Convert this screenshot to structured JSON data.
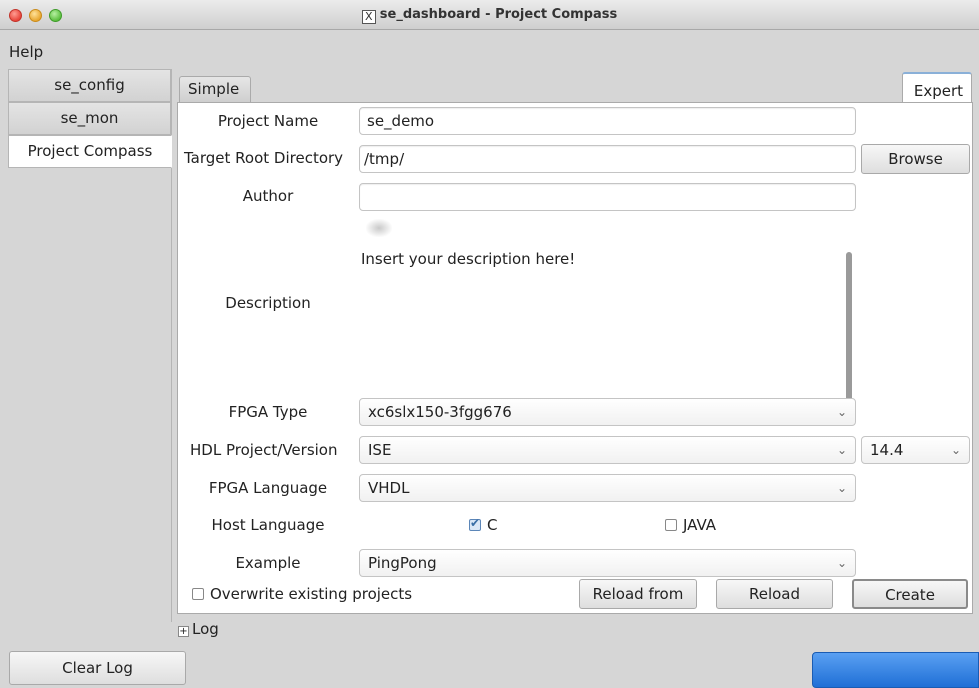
{
  "window": {
    "title": "se_dashboard - Project Compass",
    "x_glyph": "X"
  },
  "menu": {
    "help": "Help"
  },
  "left_tabs": [
    {
      "label": "se_config"
    },
    {
      "label": "se_mon"
    },
    {
      "label": "Project Compass"
    }
  ],
  "tabs": {
    "simple": "Simple",
    "expert": "Expert"
  },
  "form": {
    "project_name_label": "Project Name",
    "project_name_value": "se_demo",
    "target_root_label": "Target Root Directory",
    "target_root_value": "/tmp/",
    "browse_label": "Browse",
    "author_label": "Author",
    "description_label": "Description",
    "description_value": "Insert your description here!",
    "fpga_type_label": "FPGA Type",
    "fpga_type_value": "xc6slx150-3fgg676",
    "hdl_label": "HDL Project/Version",
    "hdl_value": "ISE",
    "hdl_version_value": "14.4",
    "fpga_language_label": "FPGA Language",
    "fpga_language_value": "VHDL",
    "host_language_label": "Host Language",
    "host_c_label": "C",
    "host_java_label": "JAVA",
    "example_label": "Example",
    "example_value": "PingPong",
    "overwrite_label": "Overwrite existing projects",
    "reload_from_label": "Reload from",
    "reload_label": "Reload",
    "create_label": "Create"
  },
  "log": {
    "toggle_label": "Log",
    "clear_label": "Clear Log"
  },
  "colors": {
    "accent_blue": "#2f7fe0",
    "tab_highlight": "#8ab0d8"
  }
}
